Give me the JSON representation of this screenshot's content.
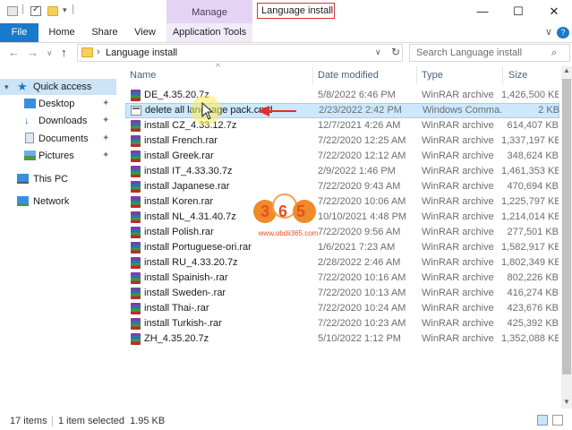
{
  "window": {
    "title": "Language install",
    "context_tab": "Manage",
    "controls": {
      "minimize": "—",
      "maximize": "☐",
      "close": "✕"
    }
  },
  "ribbon": {
    "tabs": [
      "File",
      "Home",
      "Share",
      "View",
      "Application Tools"
    ],
    "help": "?"
  },
  "address": {
    "back": "←",
    "forward": "→",
    "history": "∨",
    "up": "↑",
    "separator": "›",
    "path": "Language install",
    "dropdown": "∨",
    "refresh": "↻",
    "search_placeholder": "Search Language install"
  },
  "nav": {
    "quick_access": "Quick access",
    "items": [
      {
        "label": "Desktop",
        "icon": "desktop-icon",
        "pinned": true
      },
      {
        "label": "Downloads",
        "icon": "downloads-icon",
        "pinned": true
      },
      {
        "label": "Documents",
        "icon": "documents-icon",
        "pinned": true
      },
      {
        "label": "Pictures",
        "icon": "pictures-icon",
        "pinned": true
      }
    ],
    "this_pc": "This PC",
    "network": "Network",
    "pin_glyph": "✦"
  },
  "columns": {
    "name": "Name",
    "date": "Date modified",
    "type": "Type",
    "size": "Size",
    "sort_glyph": "^"
  },
  "files": [
    {
      "name": "DE_4.35.20.7z",
      "date": "5/8/2022 6:46 PM",
      "type": "WinRAR archive",
      "size": "1,426,500 KB",
      "icon": "rar"
    },
    {
      "name": "delete all language pack.cmd",
      "date": "2/23/2022 2:42 PM",
      "type": "Windows Comma...",
      "size": "2 KB",
      "icon": "cmd",
      "selected": true
    },
    {
      "name": "install CZ_4.33.12.7z",
      "date": "12/7/2021 4:26 AM",
      "type": "WinRAR archive",
      "size": "614,407 KB",
      "icon": "rar"
    },
    {
      "name": "install French.rar",
      "date": "7/22/2020 12:25 AM",
      "type": "WinRAR archive",
      "size": "1,337,197 KB",
      "icon": "rar"
    },
    {
      "name": "install Greek.rar",
      "date": "7/22/2020 12:12 AM",
      "type": "WinRAR archive",
      "size": "348,624 KB",
      "icon": "rar"
    },
    {
      "name": "install IT_4.33.30.7z",
      "date": "2/9/2022 1:46 PM",
      "type": "WinRAR archive",
      "size": "1,461,353 KB",
      "icon": "rar"
    },
    {
      "name": "install Japanese.rar",
      "date": "7/22/2020 9:43 AM",
      "type": "WinRAR archive",
      "size": "470,694 KB",
      "icon": "rar"
    },
    {
      "name": "install Koren.rar",
      "date": "7/22/2020 10:06 AM",
      "type": "WinRAR archive",
      "size": "1,225,797 KB",
      "icon": "rar"
    },
    {
      "name": "install NL_4.31.40.7z",
      "date": "10/10/2021 4:48 PM",
      "type": "WinRAR archive",
      "size": "1,214,014 KB",
      "icon": "rar"
    },
    {
      "name": "install Polish.rar",
      "date": "7/22/2020 9:56 AM",
      "type": "WinRAR archive",
      "size": "277,501 KB",
      "icon": "rar"
    },
    {
      "name": "install Portuguese-ori.rar",
      "date": "1/6/2021 7:23 AM",
      "type": "WinRAR archive",
      "size": "1,582,917 KB",
      "icon": "rar"
    },
    {
      "name": "install RU_4.33.20.7z",
      "date": "2/28/2022 2:46 AM",
      "type": "WinRAR archive",
      "size": "1,802,349 KB",
      "icon": "rar"
    },
    {
      "name": "install Spainish-.rar",
      "date": "7/22/2020 10:16 AM",
      "type": "WinRAR archive",
      "size": "802,226 KB",
      "icon": "rar"
    },
    {
      "name": "install Sweden-.rar",
      "date": "7/22/2020 10:13 AM",
      "type": "WinRAR archive",
      "size": "416,274 KB",
      "icon": "rar"
    },
    {
      "name": "install Thai-.rar",
      "date": "7/22/2020 10:24 AM",
      "type": "WinRAR archive",
      "size": "423,676 KB",
      "icon": "rar"
    },
    {
      "name": "install Turkish-.rar",
      "date": "7/22/2020 10:23 AM",
      "type": "WinRAR archive",
      "size": "425,392 KB",
      "icon": "rar"
    },
    {
      "name": "ZH_4.35.20.7z",
      "date": "5/10/2022 1:12 PM",
      "type": "WinRAR archive",
      "size": "1,352,088 KB",
      "icon": "rar"
    }
  ],
  "status": {
    "count": "17 items",
    "selection": "1 item selected  1.95 KB"
  },
  "watermark": {
    "number": "365",
    "url": "www.obdii365.com"
  },
  "colors": {
    "accent": "#1979ca",
    "manage": "#e4d3f3",
    "selection": "#cce8ff",
    "annotation": "#e0302a"
  }
}
